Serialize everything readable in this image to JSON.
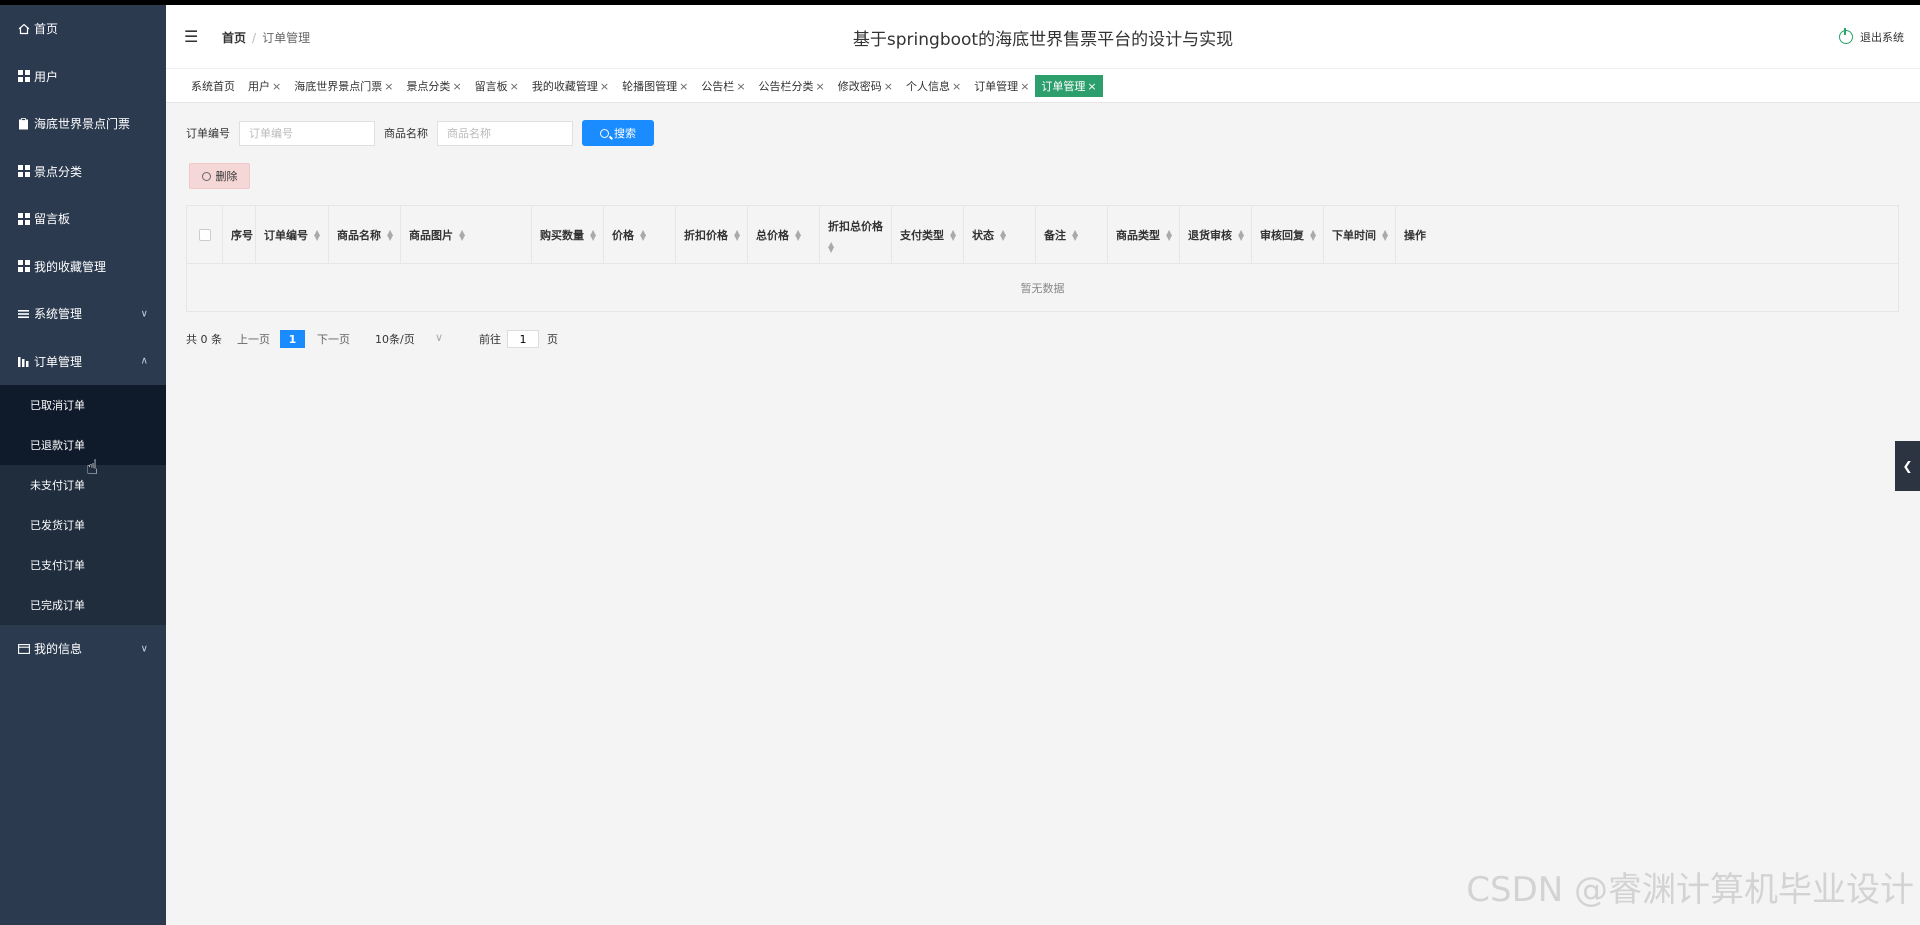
{
  "sidebar": {
    "items": [
      {
        "label": "首页",
        "icon": "home-icon"
      },
      {
        "label": "用户",
        "icon": "grid-icon"
      },
      {
        "label": "海底世界景点门票",
        "icon": "clipboard-icon"
      },
      {
        "label": "景点分类",
        "icon": "grid-icon"
      },
      {
        "label": "留言板",
        "icon": "grid-icon"
      },
      {
        "label": "我的收藏管理",
        "icon": "grid-icon"
      },
      {
        "label": "系统管理",
        "icon": "list-icon"
      },
      {
        "label": "订单管理",
        "icon": "bar-chart-icon"
      }
    ],
    "sub_items": [
      "已取消订单",
      "已退款订单",
      "未支付订单",
      "已发货订单",
      "已支付订单",
      "已完成订单"
    ],
    "last_item": {
      "label": "我的信息",
      "icon": "id-card-icon"
    }
  },
  "header": {
    "breadcrumb_home": "首页",
    "breadcrumb_sep": "/",
    "breadcrumb_current": "订单管理",
    "title": "基于springboot的海底世界售票平台的设计与实现",
    "logout": "退出系统"
  },
  "tabs": [
    {
      "label": "系统首页",
      "closable": false
    },
    {
      "label": "用户",
      "closable": true
    },
    {
      "label": "海底世界景点门票",
      "closable": true
    },
    {
      "label": "景点分类",
      "closable": true
    },
    {
      "label": "留言板",
      "closable": true
    },
    {
      "label": "我的收藏管理",
      "closable": true
    },
    {
      "label": "轮播图管理",
      "closable": true
    },
    {
      "label": "公告栏",
      "closable": true
    },
    {
      "label": "公告栏分类",
      "closable": true
    },
    {
      "label": "修改密码",
      "closable": true
    },
    {
      "label": "个人信息",
      "closable": true
    },
    {
      "label": "订单管理",
      "closable": true
    },
    {
      "label": "订单管理",
      "closable": true,
      "active": true
    }
  ],
  "search": {
    "order_no_label": "订单编号",
    "order_no_placeholder": "订单编号",
    "order_no_value": "",
    "product_label": "商品名称",
    "product_placeholder": "商品名称",
    "product_value": "",
    "search_button": "搜索"
  },
  "delete_button": "删除",
  "table": {
    "columns": [
      "序号",
      "订单编号",
      "商品名称",
      "商品图片",
      "购买数量",
      "价格",
      "折扣价格",
      "总价格",
      "折扣总价格",
      "支付类型",
      "状态",
      "备注",
      "商品类型",
      "退货审核",
      "审核回复",
      "下单时间",
      "操作"
    ],
    "empty_text": "暂无数据"
  },
  "pagination": {
    "total": "共 0 条",
    "prev": "上一页",
    "current_page": "1",
    "next": "下一页",
    "page_size": "10条/页",
    "goto_label": "前往",
    "goto_value": "1",
    "goto_suffix": "页"
  },
  "watermark": "CSDN @睿渊计算机毕业设计",
  "colors": {
    "sidebar_bg": "#2b3a4f",
    "primary": "#1a8cff",
    "active_tab": "#2c9f6d",
    "delete_bg": "#f6d7d8"
  }
}
